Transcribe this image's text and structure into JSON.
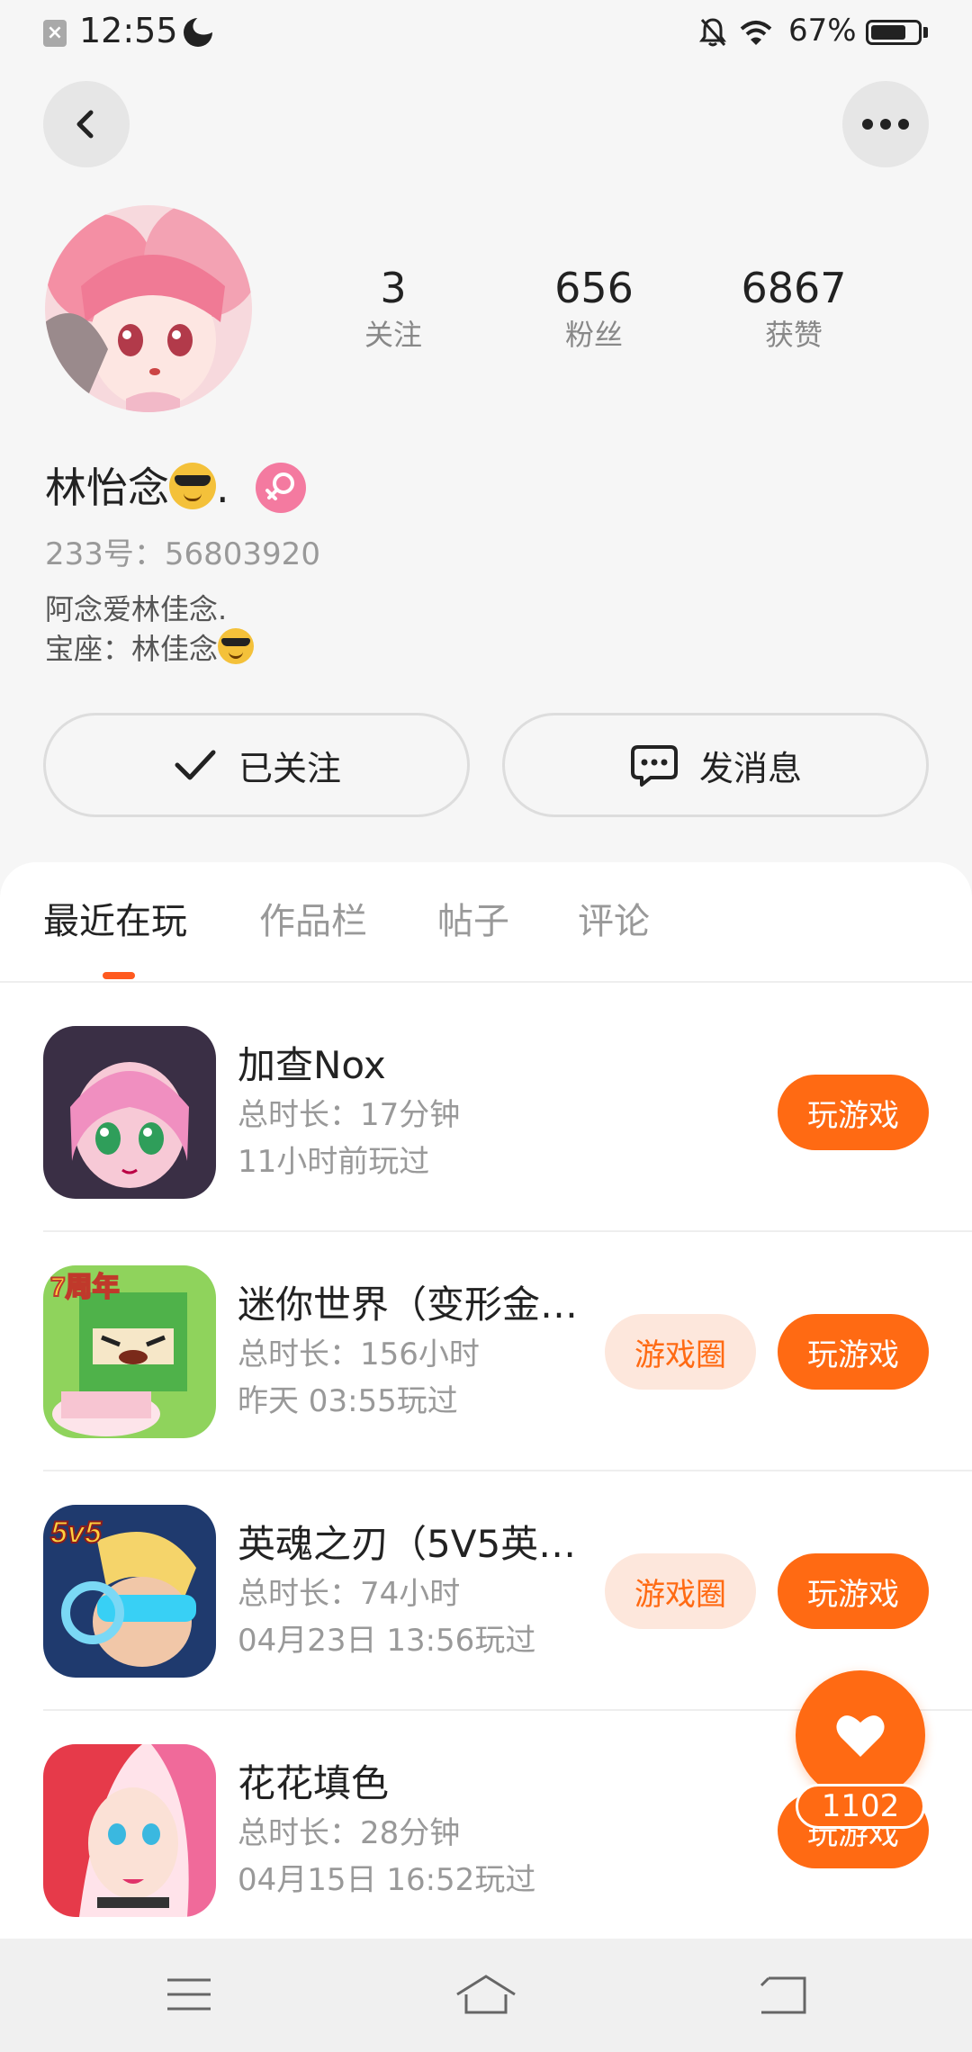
{
  "status_bar": {
    "time": "12:55",
    "battery": "67%",
    "icons": [
      "notification-x-icon",
      "moon-icon",
      "bell-off-icon",
      "wifi-icon",
      "battery-icon"
    ]
  },
  "header": {
    "back_icon": "chevron-left-icon",
    "more_icon": "more-horizontal-icon"
  },
  "profile": {
    "stats": [
      {
        "value": "3",
        "label": "关注"
      },
      {
        "value": "656",
        "label": "粉丝"
      },
      {
        "value": "6867",
        "label": "获赞"
      }
    ],
    "name": "林怡念",
    "name_suffix": ".",
    "gender_icon": "female-icon",
    "uid": "233号：56803920",
    "bio_line1": "阿念爱林佳念.",
    "bio_line2": "宝座：林佳念"
  },
  "actions": {
    "follow_label": "已关注",
    "message_label": "发消息"
  },
  "tabs": [
    {
      "label": "最近在玩",
      "active": true
    },
    {
      "label": "作品栏",
      "active": false
    },
    {
      "label": "帖子",
      "active": false
    },
    {
      "label": "评论",
      "active": false
    }
  ],
  "games": [
    {
      "title": "加查Nox",
      "duration": "总时长：17分钟",
      "last_played": "11小时前玩过",
      "circle_label": null,
      "play_label": "玩游戏"
    },
    {
      "title": "迷你世界（变形金…",
      "duration": "总时长：156小时",
      "last_played": "昨天 03:55玩过",
      "circle_label": "游戏圈",
      "play_label": "玩游戏"
    },
    {
      "title": "英魂之刃（5V5英…",
      "duration": "总时长：74小时",
      "last_played": "04月23日 13:56玩过",
      "circle_label": "游戏圈",
      "play_label": "玩游戏"
    },
    {
      "title": "花花填色",
      "duration": "总时长：28分钟",
      "last_played": "04月15日 16:52玩过",
      "circle_label": null,
      "play_label": "玩游戏"
    }
  ],
  "like_fab": {
    "count": "1102",
    "icon": "heart-icon"
  },
  "nav_bar": {
    "icons": [
      "menu-icon",
      "home-icon",
      "back-icon"
    ]
  },
  "colors": {
    "accent": "#ff6a13",
    "accent_light": "#fde7dc",
    "background": "#f6f6f6",
    "tab_indicator": "#ff5a1f"
  }
}
